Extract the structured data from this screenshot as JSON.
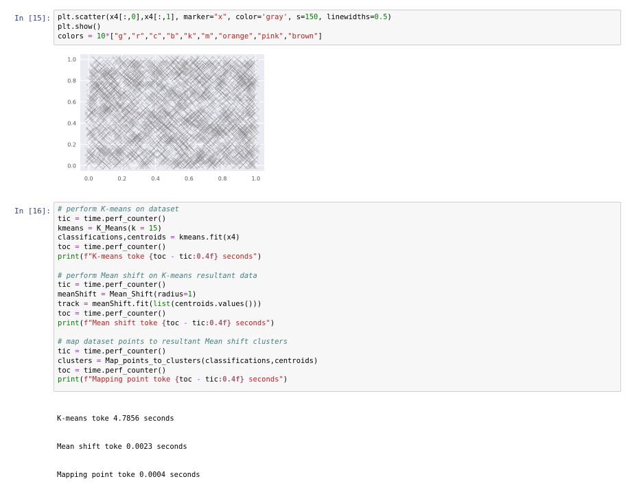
{
  "cells": [
    {
      "prompt": "In [15]:",
      "lines": [
        [
          [
            "t",
            "plt.scatter(x4[:,"
          ],
          [
            "num",
            "0"
          ],
          [
            "t",
            "],x4[:,"
          ],
          [
            "num",
            "1"
          ],
          [
            "t",
            "], marker="
          ],
          [
            "str",
            "\"x\""
          ],
          [
            "t",
            ", color="
          ],
          [
            "str",
            "'gray'"
          ],
          [
            "t",
            ", s="
          ],
          [
            "num",
            "150"
          ],
          [
            "t",
            ", linewidths="
          ],
          [
            "num",
            "0.5"
          ],
          [
            "t",
            ")"
          ]
        ],
        [
          [
            "t",
            "plt.show()"
          ]
        ],
        [
          [
            "t",
            "colors "
          ],
          [
            "op",
            "="
          ],
          [
            "t",
            " "
          ],
          [
            "num",
            "10"
          ],
          [
            "op",
            "*"
          ],
          [
            "t",
            "["
          ],
          [
            "str",
            "\"g\""
          ],
          [
            "t",
            ","
          ],
          [
            "str",
            "\"r\""
          ],
          [
            "t",
            ","
          ],
          [
            "str",
            "\"c\""
          ],
          [
            "t",
            ","
          ],
          [
            "str",
            "\"b\""
          ],
          [
            "t",
            ","
          ],
          [
            "str",
            "\"k\""
          ],
          [
            "t",
            ","
          ],
          [
            "str",
            "\"m\""
          ],
          [
            "t",
            ","
          ],
          [
            "str",
            "\"orange\""
          ],
          [
            "t",
            ","
          ],
          [
            "str",
            "\"pink\""
          ],
          [
            "t",
            ","
          ],
          [
            "str",
            "\"brown\""
          ],
          [
            "t",
            "]"
          ]
        ]
      ]
    },
    {
      "prompt": "In [16]:",
      "lines": [
        [
          [
            "com",
            "# perform K-means on dataset"
          ]
        ],
        [
          [
            "t",
            "tic "
          ],
          [
            "op",
            "="
          ],
          [
            "t",
            " time.perf_counter()"
          ]
        ],
        [
          [
            "t",
            "kmeans "
          ],
          [
            "op",
            "="
          ],
          [
            "t",
            " K_Means(k "
          ],
          [
            "op",
            "="
          ],
          [
            "t",
            " "
          ],
          [
            "num",
            "15"
          ],
          [
            "t",
            ")"
          ]
        ],
        [
          [
            "t",
            "classifications,centroids "
          ],
          [
            "op",
            "="
          ],
          [
            "t",
            " kmeans.fit(x4)"
          ]
        ],
        [
          [
            "t",
            "toc "
          ],
          [
            "op",
            "="
          ],
          [
            "t",
            " time.perf_counter()"
          ]
        ],
        [
          [
            "fn",
            "print"
          ],
          [
            "t",
            "("
          ],
          [
            "str",
            "f\"K-means toke "
          ],
          [
            "interp",
            "{"
          ],
          [
            "t",
            "toc "
          ],
          [
            "op",
            "-"
          ],
          [
            "t",
            " tic"
          ],
          [
            "interp",
            ":0.4f}"
          ],
          [
            "str",
            " seconds\""
          ],
          [
            "t",
            ")"
          ]
        ],
        [],
        [
          [
            "com",
            "# perform Mean shift on K-means resultant data"
          ]
        ],
        [
          [
            "t",
            "tic "
          ],
          [
            "op",
            "="
          ],
          [
            "t",
            " time.perf_counter()"
          ]
        ],
        [
          [
            "t",
            "meanShift "
          ],
          [
            "op",
            "="
          ],
          [
            "t",
            " Mean_Shift(radius"
          ],
          [
            "op",
            "="
          ],
          [
            "num",
            "1"
          ],
          [
            "t",
            ")"
          ]
        ],
        [
          [
            "t",
            "track "
          ],
          [
            "op",
            "="
          ],
          [
            "t",
            " meanShift.fit("
          ],
          [
            "fn",
            "list"
          ],
          [
            "t",
            "(centroids.values()))"
          ]
        ],
        [
          [
            "t",
            "toc "
          ],
          [
            "op",
            "="
          ],
          [
            "t",
            " time.perf_counter()"
          ]
        ],
        [
          [
            "fn",
            "print"
          ],
          [
            "t",
            "("
          ],
          [
            "str",
            "f\"Mean shift toke "
          ],
          [
            "interp",
            "{"
          ],
          [
            "t",
            "toc "
          ],
          [
            "op",
            "-"
          ],
          [
            "t",
            " tic"
          ],
          [
            "interp",
            ":0.4f}"
          ],
          [
            "str",
            " seconds\""
          ],
          [
            "t",
            ")"
          ]
        ],
        [],
        [
          [
            "com",
            "# map dataset points to resultant Mean shift clusters"
          ]
        ],
        [
          [
            "t",
            "tic "
          ],
          [
            "op",
            "="
          ],
          [
            "t",
            " time.perf_counter()"
          ]
        ],
        [
          [
            "t",
            "clusters "
          ],
          [
            "op",
            "="
          ],
          [
            "t",
            " Map_points_to_clusters(classifications,centroids)"
          ]
        ],
        [
          [
            "t",
            "toc "
          ],
          [
            "op",
            "="
          ],
          [
            "t",
            " time.perf_counter()"
          ]
        ],
        [
          [
            "fn",
            "print"
          ],
          [
            "t",
            "("
          ],
          [
            "str",
            "f\"Mapping point toke "
          ],
          [
            "interp",
            "{"
          ],
          [
            "t",
            "toc "
          ],
          [
            "op",
            "-"
          ],
          [
            "t",
            " tic"
          ],
          [
            "interp",
            ":0.4f}"
          ],
          [
            "str",
            " seconds\""
          ],
          [
            "t",
            ")"
          ]
        ]
      ]
    }
  ],
  "output_16": [
    "K-means toke 4.7856 seconds",
    "Mean shift toke 0.0023 seconds",
    "Mapping point toke 0.0004 seconds"
  ],
  "chart_data": {
    "type": "scatter",
    "marker": "x",
    "color": "gray",
    "background": "#eaeaf2",
    "grid": true,
    "xlim": [
      0.0,
      1.0
    ],
    "ylim": [
      0.0,
      1.0
    ],
    "x_ticks": [
      "0.0",
      "0.2",
      "0.4",
      "0.6",
      "0.8",
      "1.0"
    ],
    "y_ticks": [
      "0.0",
      "0.2",
      "0.4",
      "0.6",
      "0.8",
      "1.0"
    ],
    "point_count": 1500,
    "distribution": "uniform"
  }
}
